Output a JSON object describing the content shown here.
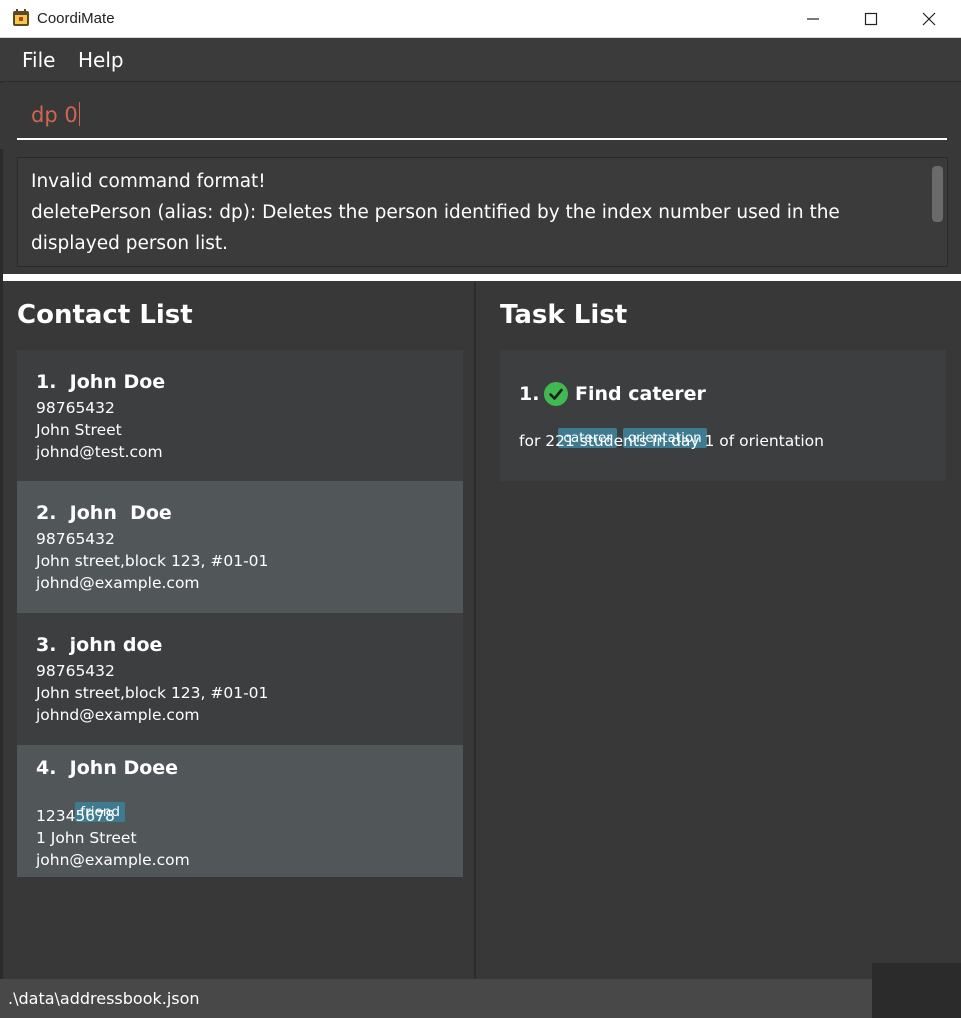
{
  "window": {
    "title": "CoordiMate",
    "controls": [
      "minimize-icon",
      "maximize-icon",
      "close-icon"
    ]
  },
  "menu": {
    "file": "File",
    "help": "Help"
  },
  "command": {
    "value": "dp 0"
  },
  "result": {
    "text": "Invalid command format!\ndeletePerson (alias: dp): Deletes the person identified by the index number used in the displayed person list."
  },
  "contacts": {
    "title": "Contact List",
    "items": [
      {
        "name": "1.  John Doe",
        "tags": [],
        "phone": "98765432",
        "address": "John Street",
        "email": "johnd@test.com"
      },
      {
        "name": "2.  John  Doe",
        "tags": [],
        "phone": "98765432",
        "address": "John street,block 123, #01-01",
        "email": "johnd@example.com"
      },
      {
        "name": "3.  john doe",
        "tags": [],
        "phone": "98765432",
        "address": "John street,block 123, #01-01",
        "email": "johnd@example.com"
      },
      {
        "name": "4.  John Doee",
        "tags": [
          "friend"
        ],
        "phone": "12345678",
        "address": "1 John Street",
        "email": "john@example.com"
      }
    ]
  },
  "tasks": {
    "title": "Task List",
    "items": [
      {
        "index": "1.",
        "title": "Find caterer",
        "done": true,
        "tags": [
          "caterer",
          "orientation"
        ],
        "note": "for 221 students in day 1 of orientation"
      }
    ]
  },
  "status": {
    "path": ".\\data\\addressbook.json"
  },
  "colors": {
    "accent_tag": "#3e7b91",
    "command_text": "#d06651",
    "done_check": "#3fb950",
    "card_dark": "#3c3e3f",
    "card_light": "#515658"
  }
}
